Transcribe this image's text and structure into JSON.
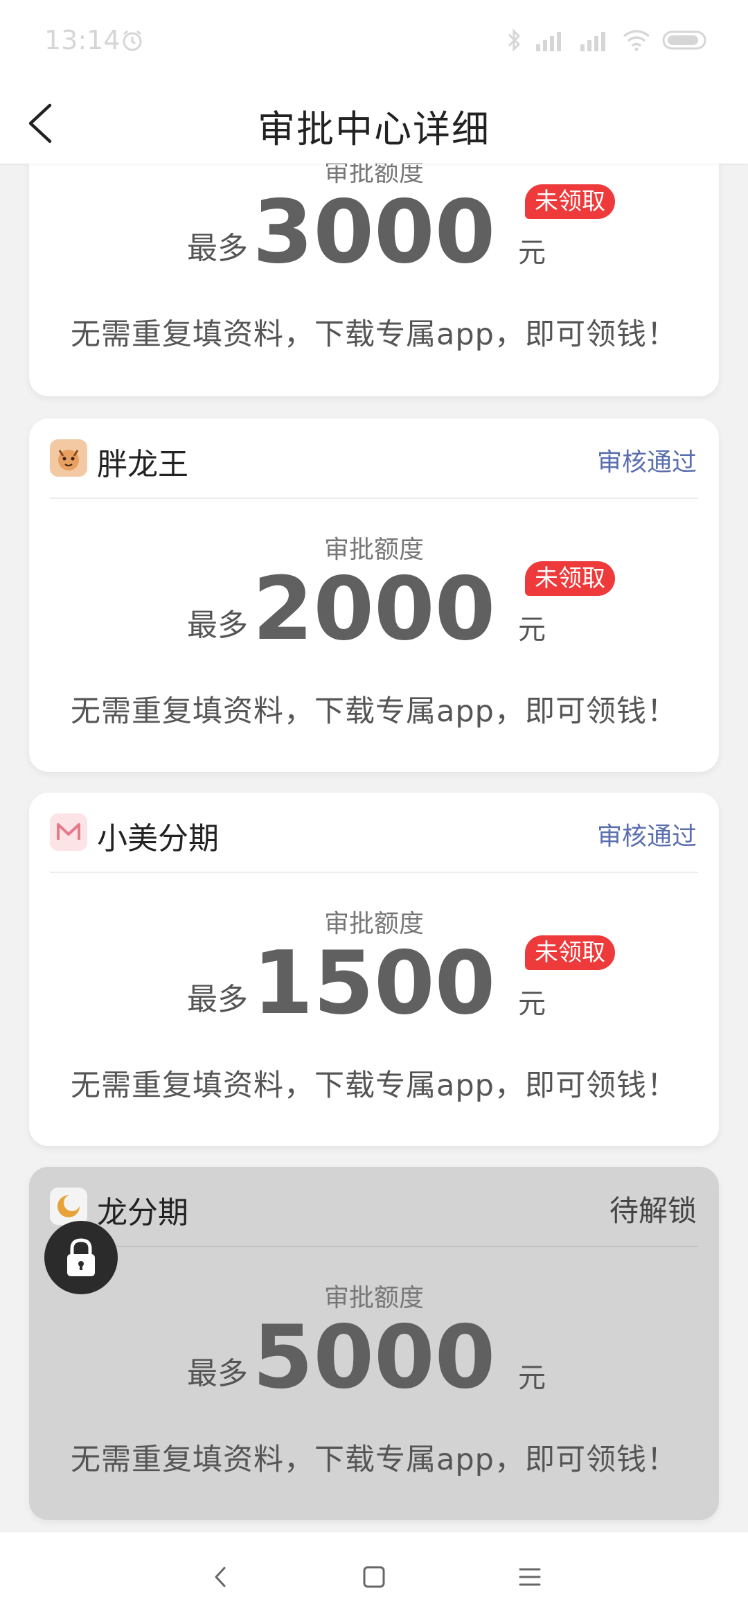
{
  "status_bar": {
    "time": "13:14"
  },
  "header": {
    "title": "审批中心详细"
  },
  "first_card": {
    "quota_label": "审批额度",
    "max_label": "最多",
    "amount": "3000",
    "unit": "元",
    "badge": "未领取",
    "description": "无需重复填资料，下载专属app，即可领钱！"
  },
  "cards": [
    {
      "app_name": "胖龙王",
      "status": "审核通过",
      "quota_label": "审批额度",
      "max_label": "最多",
      "amount": "2000",
      "unit": "元",
      "badge": "未领取",
      "description": "无需重复填资料，下载专属app，即可领钱！"
    },
    {
      "app_name": "小美分期",
      "status": "审核通过",
      "quota_label": "审批额度",
      "max_label": "最多",
      "amount": "1500",
      "unit": "元",
      "badge": "未领取",
      "description": "无需重复填资料，下载专属app，即可领钱！"
    },
    {
      "app_name": "龙分期",
      "status": "待解锁",
      "quota_label": "审批额度",
      "max_label": "最多",
      "amount": "5000",
      "unit": "元",
      "description": "无需重复填资料，下载专属app，即可领钱！"
    }
  ],
  "colors": {
    "badge": "#ee3a3a",
    "status_approved": "#5b6fb0",
    "locked_card": "#d3d3d3",
    "amount": "#606060"
  },
  "icons": {
    "back": "chevron-left-icon",
    "lock": "lock-icon",
    "nav_back": "nav-back-icon",
    "nav_home": "nav-home-icon",
    "nav_menu": "nav-menu-icon"
  }
}
